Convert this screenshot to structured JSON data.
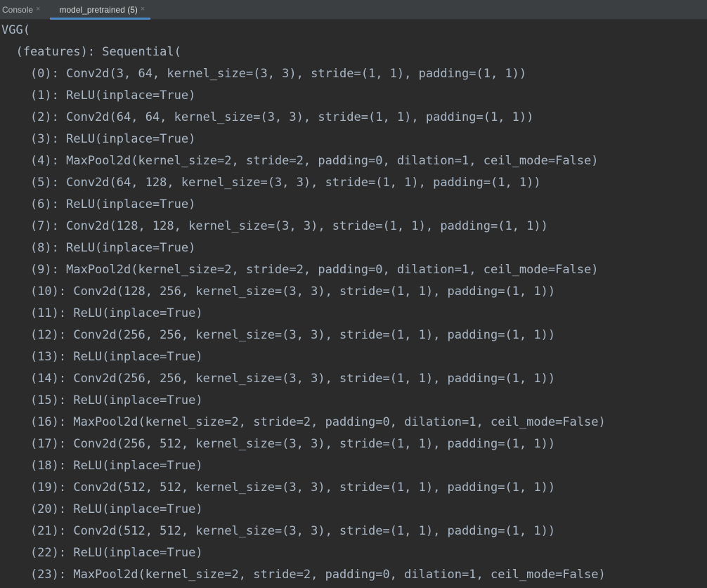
{
  "tabs": [
    {
      "label": "Console",
      "active": false
    },
    {
      "label": "model_pretrained (5)",
      "active": true
    }
  ],
  "close_glyph": "×",
  "colors": {
    "background": "#2b2b2b",
    "tabbar": "#3c3f41",
    "text": "#a9b7c6",
    "accent": "#4a88c7"
  },
  "console_lines": [
    "VGG(",
    "  (features): Sequential(",
    "    (0): Conv2d(3, 64, kernel_size=(3, 3), stride=(1, 1), padding=(1, 1))",
    "    (1): ReLU(inplace=True)",
    "    (2): Conv2d(64, 64, kernel_size=(3, 3), stride=(1, 1), padding=(1, 1))",
    "    (3): ReLU(inplace=True)",
    "    (4): MaxPool2d(kernel_size=2, stride=2, padding=0, dilation=1, ceil_mode=False)",
    "    (5): Conv2d(64, 128, kernel_size=(3, 3), stride=(1, 1), padding=(1, 1))",
    "    (6): ReLU(inplace=True)",
    "    (7): Conv2d(128, 128, kernel_size=(3, 3), stride=(1, 1), padding=(1, 1))",
    "    (8): ReLU(inplace=True)",
    "    (9): MaxPool2d(kernel_size=2, stride=2, padding=0, dilation=1, ceil_mode=False)",
    "    (10): Conv2d(128, 256, kernel_size=(3, 3), stride=(1, 1), padding=(1, 1))",
    "    (11): ReLU(inplace=True)",
    "    (12): Conv2d(256, 256, kernel_size=(3, 3), stride=(1, 1), padding=(1, 1))",
    "    (13): ReLU(inplace=True)",
    "    (14): Conv2d(256, 256, kernel_size=(3, 3), stride=(1, 1), padding=(1, 1))",
    "    (15): ReLU(inplace=True)",
    "    (16): MaxPool2d(kernel_size=2, stride=2, padding=0, dilation=1, ceil_mode=False)",
    "    (17): Conv2d(256, 512, kernel_size=(3, 3), stride=(1, 1), padding=(1, 1))",
    "    (18): ReLU(inplace=True)",
    "    (19): Conv2d(512, 512, kernel_size=(3, 3), stride=(1, 1), padding=(1, 1))",
    "    (20): ReLU(inplace=True)",
    "    (21): Conv2d(512, 512, kernel_size=(3, 3), stride=(1, 1), padding=(1, 1))",
    "    (22): ReLU(inplace=True)",
    "    (23): MaxPool2d(kernel_size=2, stride=2, padding=0, dilation=1, ceil_mode=False)"
  ]
}
